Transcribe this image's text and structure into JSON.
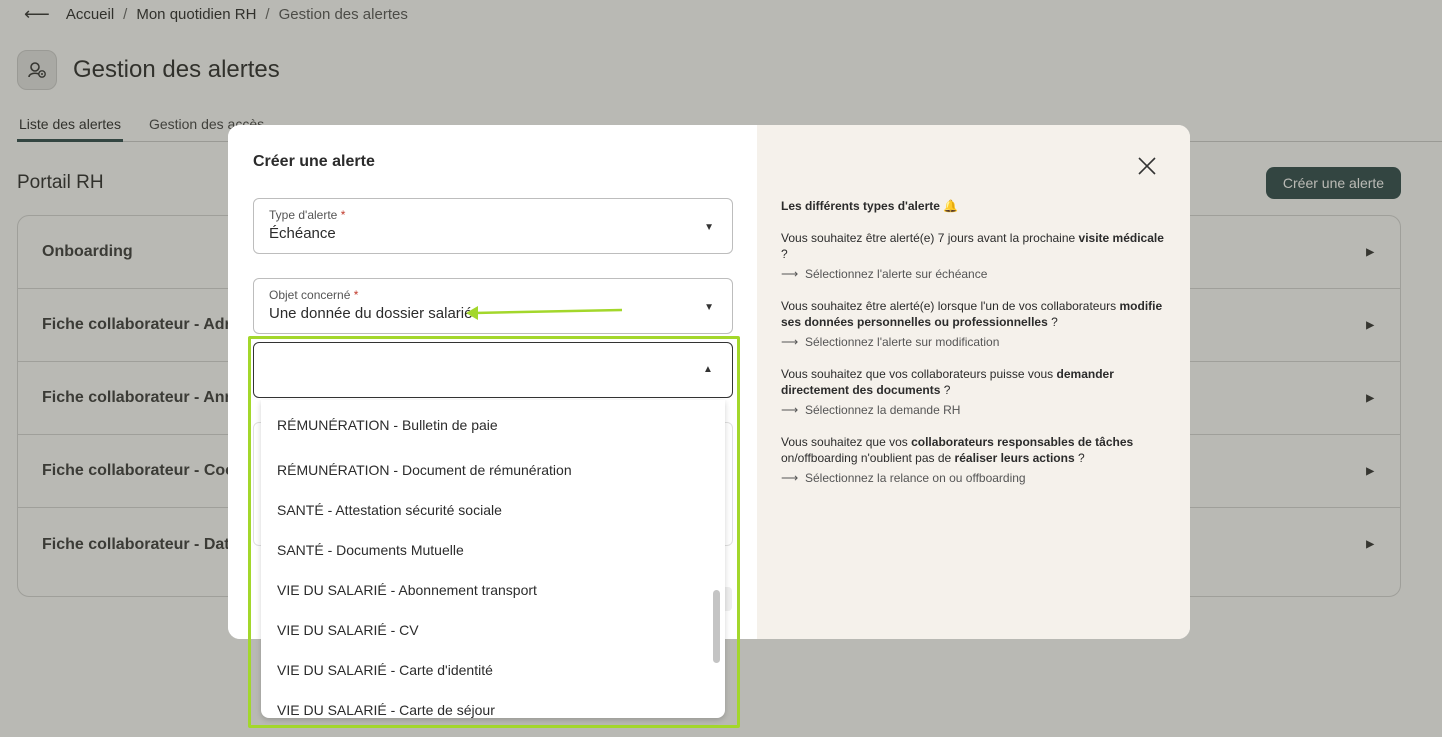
{
  "breadcrumb": {
    "back_icon": "arrow-left-icon",
    "items": [
      "Accueil",
      "Mon quotidien RH",
      "Gestion des alertes"
    ],
    "separator": "/"
  },
  "page": {
    "title": "Gestion des alertes",
    "icon": "alert-settings-icon",
    "tabs": [
      {
        "label": "Liste des alertes",
        "active": true
      },
      {
        "label": "Gestion des accès",
        "active": false
      }
    ],
    "section_title": "Portail RH",
    "create_button": "Créer une alerte",
    "accordion": [
      "Onboarding",
      "Fiche collaborateur - Adre",
      "Fiche collaborateur - Anni",
      "Fiche collaborateur - Coor",
      "Fiche collaborateur - Date"
    ]
  },
  "modal": {
    "title": "Créer une alerte",
    "type_field": {
      "label": "Type d'alerte",
      "required_mark": "*",
      "value": "Échéance"
    },
    "object_field": {
      "label": "Objet concerné",
      "required_mark": "*",
      "value": "Une donnée du dossier salarié"
    },
    "combobox": {
      "value": "",
      "options": [
        "RÉMUNÉRATION - Bulletin de paie",
        "RÉMUNÉRATION - Document de rémunération",
        "SANTÉ - Attestation sécurité sociale",
        "SANTÉ - Documents Mutuelle",
        "VIE DU SALARIÉ - Abonnement transport",
        "VIE DU SALARIÉ - CV",
        "VIE DU SALARIÉ - Carte d'identité",
        "VIE DU SALARIÉ - Carte de séjour"
      ]
    },
    "info": {
      "title": "Les différents types d'alerte 🔔",
      "blocks": [
        {
          "text_before": "Vous souhaitez être alerté(e) 7 jours avant la prochaine ",
          "bold": "visite médicale",
          "text_after": " ?",
          "link": "Sélectionnez l'alerte sur échéance"
        },
        {
          "text_before": "Vous souhaitez être alerté(e) lorsque l'un de vos collaborateurs ",
          "bold": "modifie ses données personnelles ou professionnelles",
          "text_after": " ?",
          "link": "Sélectionnez l'alerte sur modification"
        },
        {
          "text_before": "Vous souhaitez que vos collaborateurs puisse vous ",
          "bold": "demander directement des documents",
          "text_after": " ?",
          "link": "Sélectionnez la demande RH"
        },
        {
          "text_before": "Vous souhaitez que vos ",
          "bold": "collaborateurs responsables de tâches",
          "text_mid": " on/offboarding n'oublient pas de ",
          "bold2": "réaliser leurs actions",
          "text_after": " ?",
          "link": "Sélectionnez la relance on ou offboarding"
        }
      ],
      "link_arrow": "⟶"
    }
  },
  "colors": {
    "primary": "#2e4a4c",
    "highlight": "#a3d72b",
    "info_panel_bg": "#f5f1eb",
    "required": "#c0392b"
  }
}
